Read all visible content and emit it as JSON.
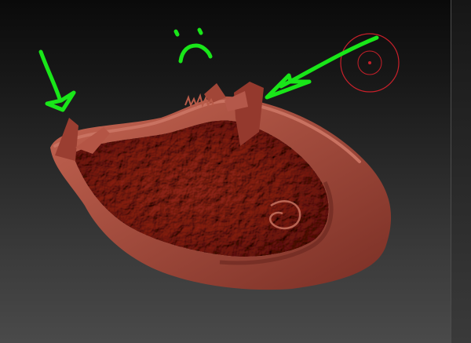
{
  "viewport": {
    "background_top": "#0a0a0a",
    "background_bottom": "#4a4a4a"
  },
  "mesh": {
    "color": "#a5483a",
    "shadow_color": "#6e2a21",
    "highlight_color": "#cf7a66"
  },
  "annotations": {
    "color": "#19e619",
    "left_arrow_icon": "arrow-down-right-icon",
    "right_arrow_icon": "arrow-down-left-icon",
    "face_icon": "sad-face-icon"
  },
  "transform_gizmo": {
    "color": "#c8202a",
    "icon": "rotation-circle-icon"
  }
}
